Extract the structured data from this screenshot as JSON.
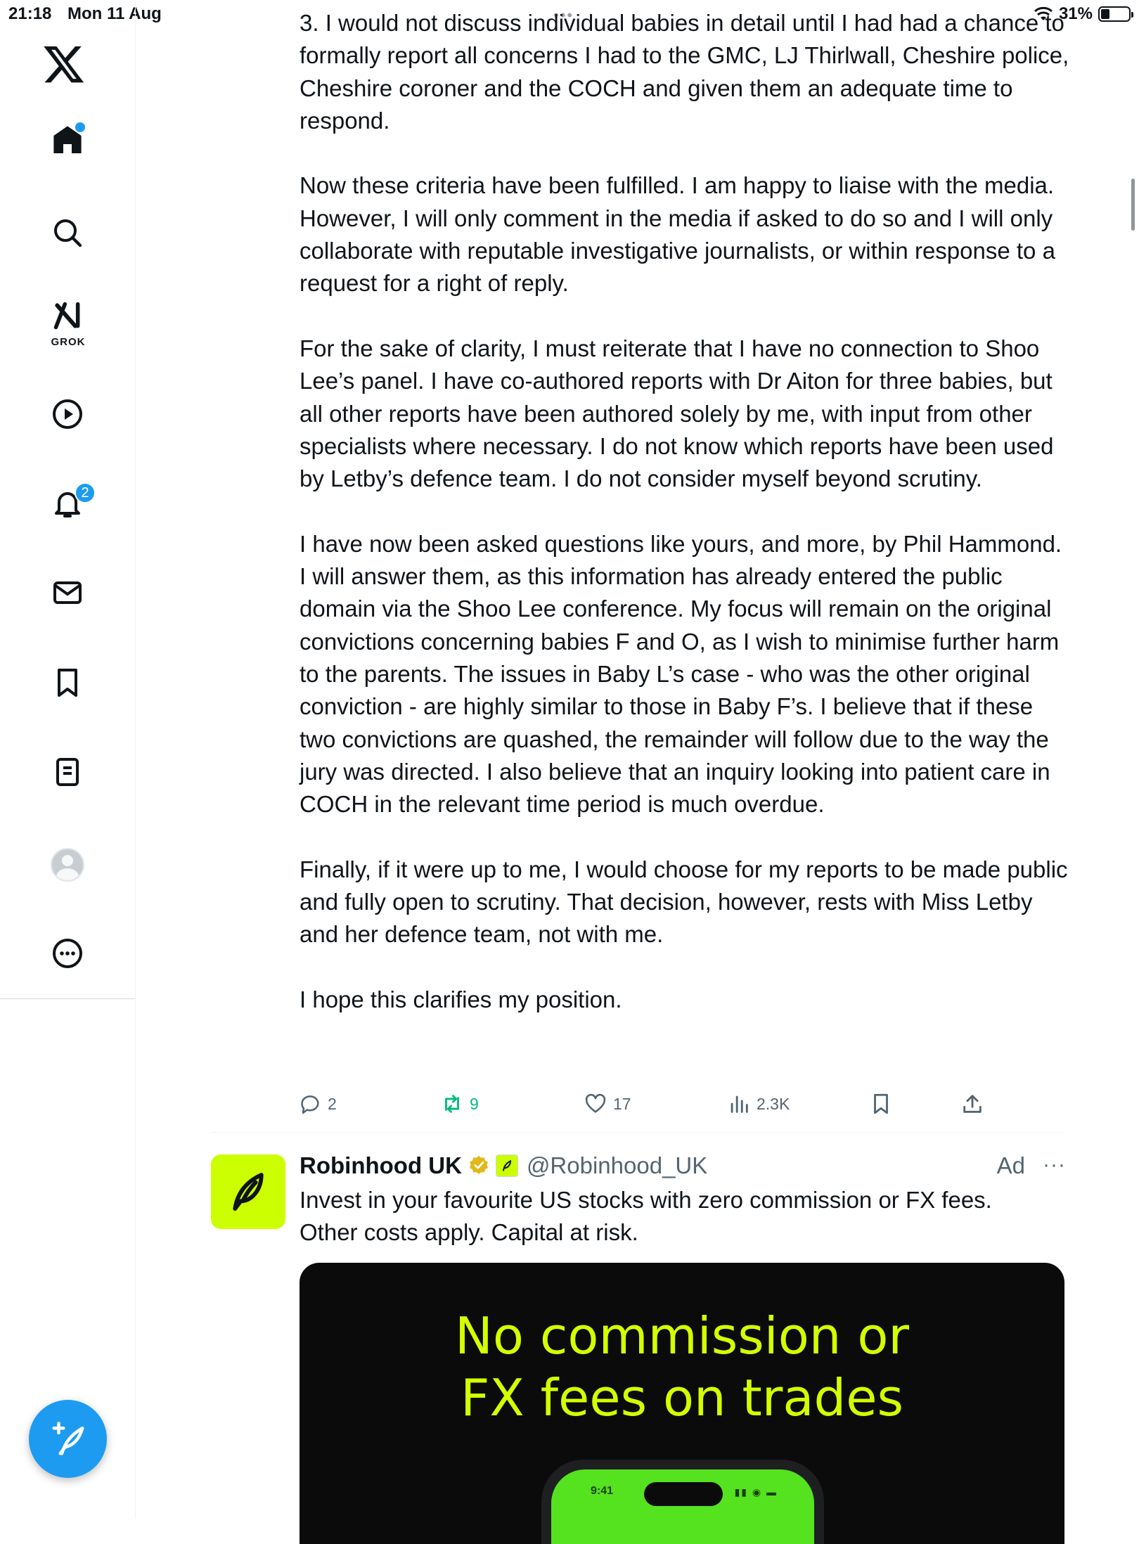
{
  "status_bar": {
    "time": "21:18",
    "date": "Mon 11 Aug",
    "battery": "31%",
    "battery_level": 0.31
  },
  "sidebar": {
    "items": [
      {
        "name": "x-logo",
        "label": ""
      },
      {
        "name": "home",
        "label": "",
        "has_dot": true
      },
      {
        "name": "search",
        "label": ""
      },
      {
        "name": "grok",
        "label": "GROK"
      },
      {
        "name": "video",
        "label": ""
      },
      {
        "name": "notifications",
        "label": "",
        "badge": "2"
      },
      {
        "name": "messages",
        "label": ""
      },
      {
        "name": "bookmarks",
        "label": ""
      },
      {
        "name": "lists",
        "label": ""
      },
      {
        "name": "profile",
        "label": ""
      },
      {
        "name": "more",
        "label": ""
      }
    ],
    "compose_icon": "compose-plus-feather-icon",
    "accent_color": "#1d9bf0"
  },
  "tweet": {
    "paragraphs": [
      "3. I would not discuss individual babies in detail until I had had a chance to formally report all concerns I had to the GMC, LJ Thirlwall, Cheshire police, Cheshire coroner and the COCH and given them an adequate time to respond.",
      "Now these criteria have been fulfilled. I am happy to liaise with the media. However, I will only comment in the media if asked to do so and I will only collaborate with reputable investigative journalists, or within response to a request for a right of reply.",
      "For the sake of clarity, I must reiterate that I have no connection to Shoo Lee’s panel. I have co-authored reports with Dr Aiton for three babies, but all other reports have been authored solely by me, with input from other specialists where necessary. I do not know which reports have been used by Letby’s defence team. I do not consider myself beyond scrutiny.",
      "I have now been asked questions like yours, and more, by Phil Hammond. I will answer them, as this information has already entered the public domain via the Shoo Lee conference. My focus will remain on the original convictions concerning babies F and O, as I wish to minimise further harm to the parents. The issues in Baby L’s case - who was the other original conviction - are highly similar to those in Baby F’s. I believe that if these two convictions are quashed, the remainder will follow due to the way the jury was directed. I also believe that an inquiry looking into patient care in COCH in the relevant time period is much overdue.",
      "Finally, if it were up to me, I would choose for my reports to be made public and fully open to scrutiny. That decision, however, rests with Miss Letby and her defence team, not with me.",
      "I hope this clarifies my position."
    ],
    "actions": {
      "replies": "2",
      "reposts": "9",
      "likes": "17",
      "views": "2.3K"
    },
    "repost_color": "#00ba7c"
  },
  "ad": {
    "name": "Robinhood UK",
    "handle": "@Robinhood_UK",
    "label": "Ad",
    "more": "···",
    "text_lines": [
      "Invest in your favourite US stocks with zero commission or FX fees.",
      "Other costs apply. Capital at risk."
    ],
    "media": {
      "headline_lines": [
        "No commission or",
        "FX fees on trades"
      ],
      "phone_time": "9:41"
    },
    "brand_color": "#ccff00",
    "headline_color": "#d4ff00"
  }
}
